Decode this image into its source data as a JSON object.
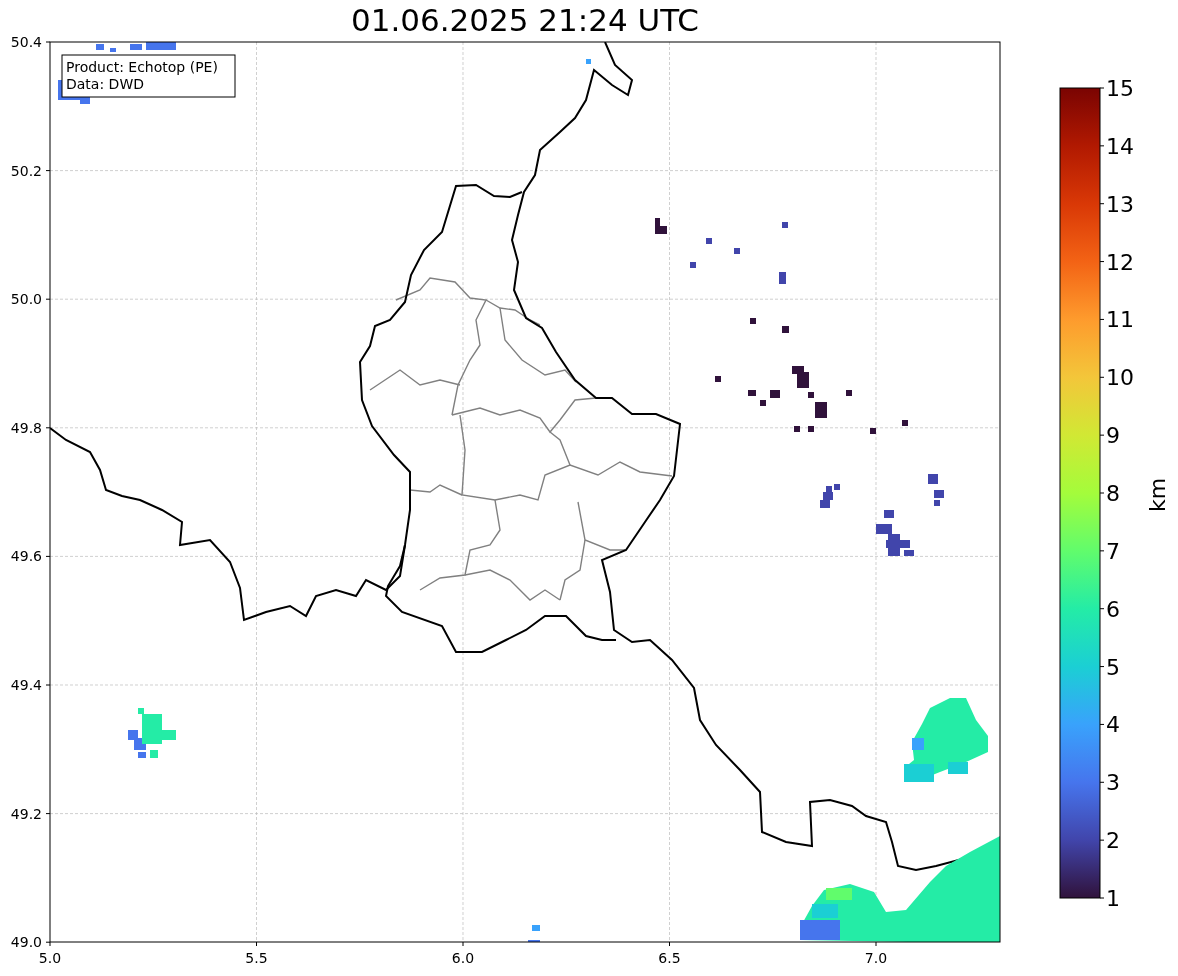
{
  "title": "01.06.2025 21:24 UTC",
  "info_box": {
    "lines": [
      "Product: Echotop (PE)",
      "Data: DWD"
    ]
  },
  "x_ticks": [
    "5.0",
    "5.5",
    "6.0",
    "6.5",
    "7.0"
  ],
  "y_ticks": [
    "50.4",
    "50.2",
    "50.0",
    "49.8",
    "49.6",
    "49.4",
    "49.2",
    "49.0"
  ],
  "colorbar": {
    "label": "km",
    "ticks": [
      "15",
      "14",
      "13",
      "12",
      "11",
      "10",
      "9",
      "8",
      "7",
      "6",
      "5",
      "4",
      "3",
      "2",
      "1"
    ]
  }
}
